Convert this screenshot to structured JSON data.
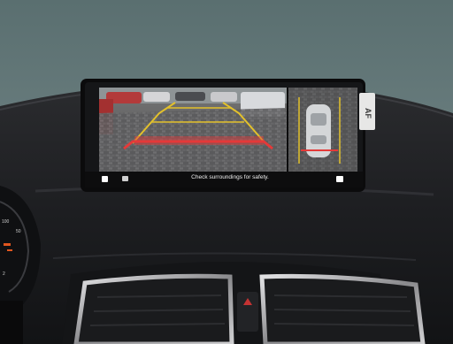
{
  "scene": {
    "type": "photo",
    "subject": "car-infotainment-rear-camera-display",
    "colors": {
      "wall": "#5e7373",
      "dashboard": "#1e1f21",
      "screen_bezel": "#0c0c0d",
      "guide_yellow": "#e3c12b",
      "guide_red": "#e43a39",
      "vent_chrome": "#b9b9bb"
    }
  },
  "screen": {
    "warning_text": "Check surroundings for safety.",
    "icons": [
      "home-icon",
      "camera-icon",
      "camera-toggle-icon"
    ]
  },
  "watermark": {
    "text": "AF"
  },
  "gauge": {
    "labels": [
      "100",
      "50",
      "2"
    ]
  }
}
